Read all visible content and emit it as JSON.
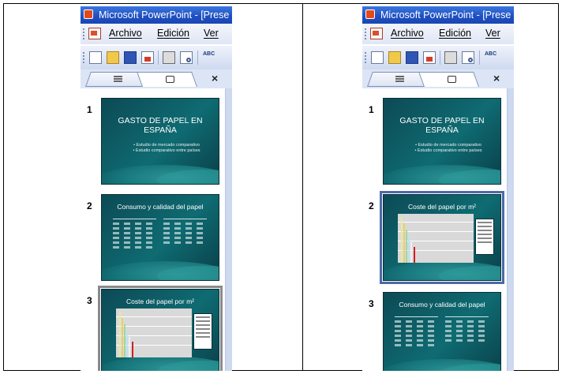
{
  "window": {
    "title": "Microsoft PowerPoint - [Prese"
  },
  "menu": [
    "Archivo",
    "Edición",
    "Ver"
  ],
  "toolbar": {
    "spell_glyph": "ABC"
  },
  "pane": {
    "close": "×"
  },
  "slides": {
    "title_slide": {
      "title": "GASTO DE PAPEL EN ESPAÑA",
      "bullets": [
        "• Estudio de mercado comparativo",
        "• Estudio comparativo entre países"
      ]
    },
    "consumo_slide": {
      "title": "Consumo y calidad del papel"
    },
    "coste_slide": {
      "title": "Coste del papel por m²"
    }
  },
  "left_panel": {
    "order": [
      "1",
      "2",
      "3"
    ],
    "selected": "3"
  },
  "right_panel": {
    "order": [
      "1",
      "2",
      "3"
    ],
    "selected": "2"
  },
  "colors": {
    "slide_bg": "#0f6b72",
    "titlebar": "#1e4fc0",
    "menubar": "#dfe6f5"
  }
}
